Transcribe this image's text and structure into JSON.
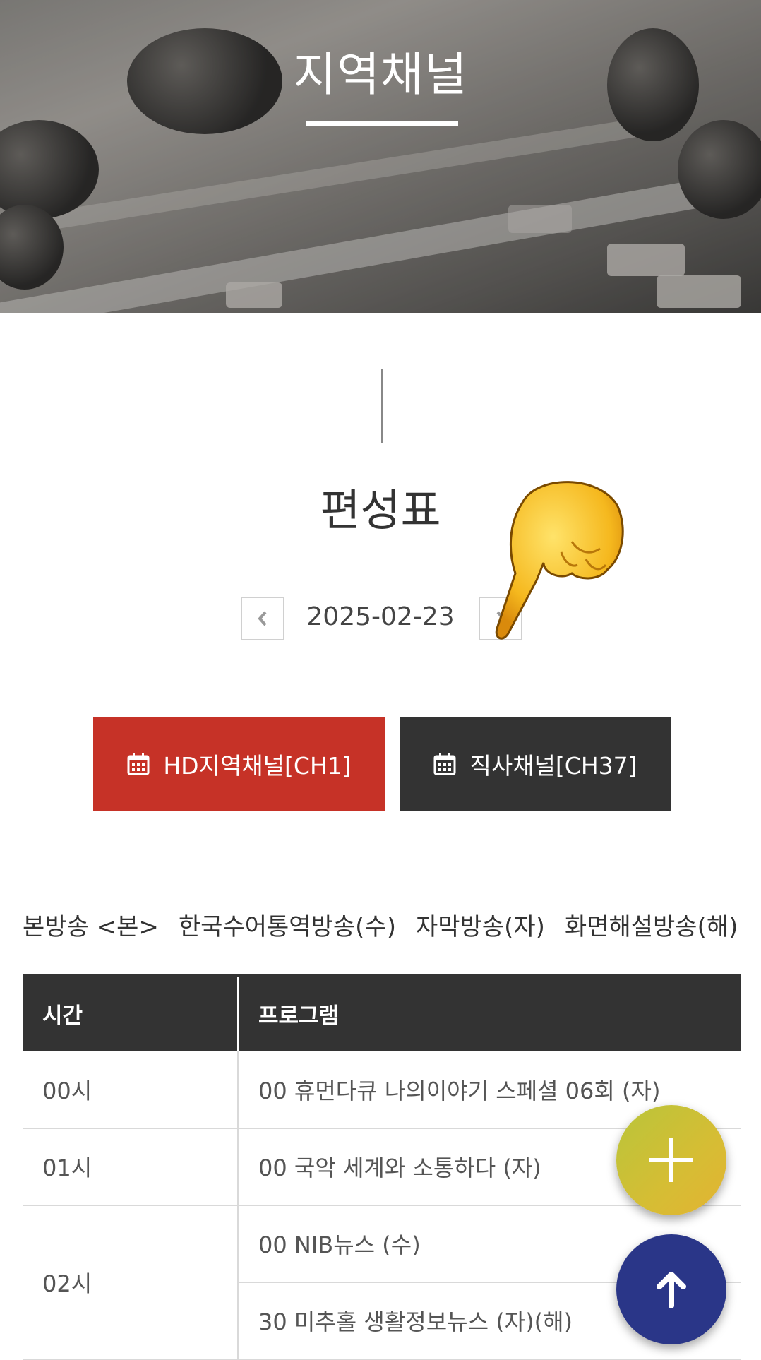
{
  "header": {
    "title": "지역채널"
  },
  "schedule": {
    "title": "편성표",
    "date": "2025-02-23",
    "prev_icon": "chevron-left-icon",
    "next_icon": "chevron-right-icon"
  },
  "channels": [
    {
      "label": "HD지역채널[CH1]",
      "icon": "calendar-icon",
      "active": true,
      "color": "#c63227"
    },
    {
      "label": "직사채널[CH37]",
      "icon": "calendar-icon",
      "active": false,
      "color": "#333333"
    }
  ],
  "legend": [
    "본방송 <본>",
    "한국수어통역방송(수)",
    "자막방송(자)",
    "화면해설방송(해)"
  ],
  "table": {
    "headers": {
      "time": "시간",
      "program": "프로그램"
    },
    "rows": [
      {
        "time": "00시",
        "programs": [
          "00 휴먼다큐 나의이야기 스페셜 06회 (자)"
        ]
      },
      {
        "time": "01시",
        "programs": [
          "00 국악 세계와 소통하다 (자)"
        ]
      },
      {
        "time": "02시",
        "programs": [
          "00 NIB뉴스 (수)",
          "30 미추홀 생활정보뉴스 (자)(해)"
        ]
      }
    ]
  },
  "fab": {
    "plus_icon": "plus-icon",
    "up_icon": "arrow-up-icon"
  },
  "colors": {
    "accent_red": "#c63227",
    "dark": "#333333",
    "fab_blue": "#2a3688",
    "fab_yellow": "#d6bd34"
  }
}
